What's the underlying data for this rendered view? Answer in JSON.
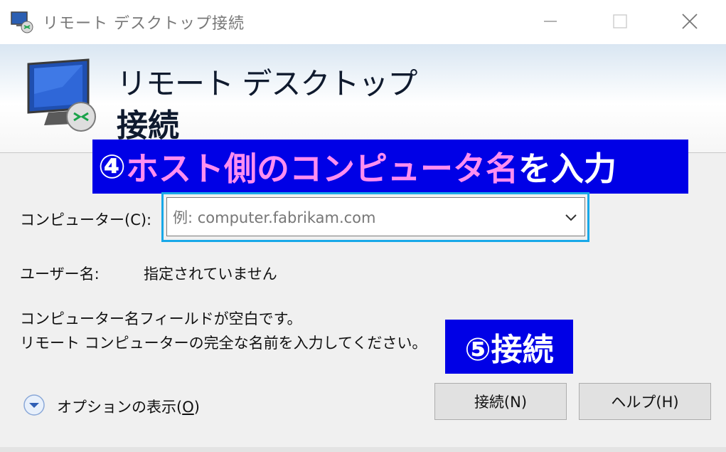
{
  "window": {
    "title": "リモート デスクトップ接続"
  },
  "banner": {
    "title_line1": "リモート デスクトップ",
    "title_line2": "接続"
  },
  "callouts": {
    "step4_prefix": "④",
    "step4_highlight": "ホスト側のコンピュータ名",
    "step4_suffix": "を入力",
    "step5": "⑤接続"
  },
  "form": {
    "computer_label": "コンピューター(C):",
    "computer_placeholder": "例: computer.fabrikam.com",
    "username_label": "ユーザー名:",
    "username_value": "指定されていません",
    "message_line1": "コンピューター名フィールドが空白です。",
    "message_line2": "リモート コンピューターの完全な名前を入力してください。"
  },
  "footer": {
    "options_label": "オプションの表示(",
    "options_accel": "O",
    "options_label_end": ")",
    "connect_button": "接続(N)",
    "help_button": "ヘルプ(H)"
  },
  "colors": {
    "callout_bg": "#0000e6",
    "callout_highlight": "#ff8ef0",
    "focus_outline": "#18a8e8"
  },
  "icons": {
    "app": "remote-desktop-icon",
    "banner": "monitor-connection-icon",
    "options": "chevron-down-circle-icon",
    "dropdown": "chevron-down-icon"
  }
}
